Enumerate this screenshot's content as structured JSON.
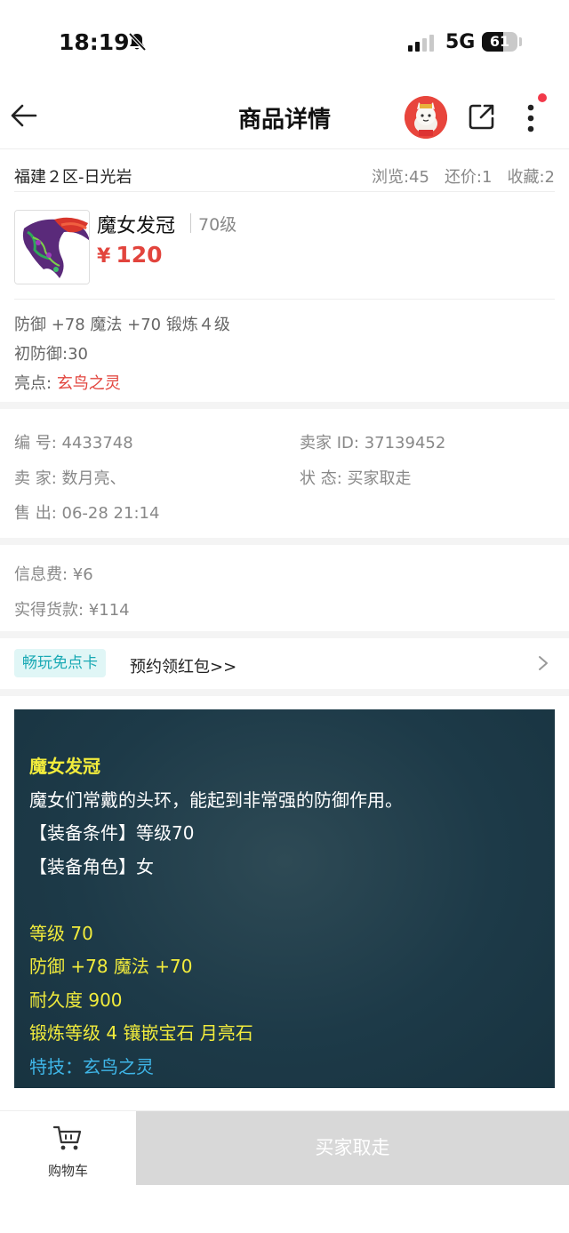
{
  "status_bar": {
    "time": "18:19",
    "network": "5G",
    "battery": "61",
    "battery_level": 0.61
  },
  "navbar": {
    "title": "商品详情"
  },
  "server": {
    "name": "福建２区-日光岩",
    "stats": [
      "浏览:45",
      "还价:1",
      "收藏:2"
    ]
  },
  "item": {
    "name": "魔女发冠",
    "level": "70级",
    "currency": "¥",
    "price": "120",
    "attrs_line1": "防御 +78 魔法 +70 锻炼４级",
    "attrs_line2": "初防御:30",
    "highlight_label": "亮点:",
    "highlight_value": "玄鸟之灵"
  },
  "order_info": {
    "id_label": "编 号:",
    "id_value": "4433748",
    "seller_id_label": "卖家 ID:",
    "seller_id_value": "37139452",
    "seller_label": "卖 家:",
    "seller_value": "数月亮、",
    "status_label": "状 态:",
    "status_value": "买家取走",
    "sold_label": "售 出:",
    "sold_value": "06-28 21:14"
  },
  "fees": {
    "info_fee": "信息费: ¥6",
    "actual": "实得货款: ¥114"
  },
  "promo": {
    "tag": "畅玩免点卡",
    "text": "预约领红包>>"
  },
  "description": {
    "title": "魔女发冠",
    "intro": "魔女们常戴的头环，能起到非常强的防御作用。",
    "req_level": "【装备条件】等级70",
    "req_role": "【装备角色】女",
    "level": "等级 70",
    "attrs": "防御 +78 魔法 +70",
    "durability": "耐久度 900",
    "forge": "锻炼等级 4 镶嵌宝石 月亮石",
    "skill": "特技：玄鸟之灵"
  },
  "bottom": {
    "cart_label": "购物车",
    "buy_label": "买家取走"
  },
  "colors": {
    "price_red": "#e2443d",
    "desc_bg": "#1d3a48",
    "desc_yellow": "#f2ec3c",
    "desc_blue": "#3fb6e8",
    "promo_teal": "#19a9b4"
  }
}
